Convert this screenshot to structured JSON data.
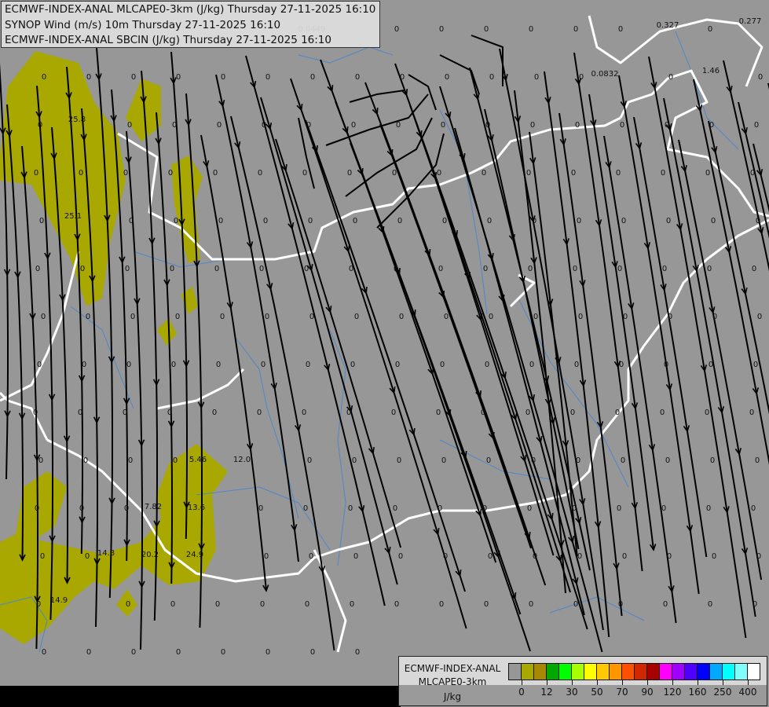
{
  "titles": [
    "ECMWF-INDEX-ANAL MLCAPE0-3km (J/kg) Thursday 27-11-2025 16:10",
    "SYNOP Wind (m/s) 10m Thursday 27-11-2025 16:10",
    "ECMWF-INDEX-ANAL SBCIN (J/kg) Thursday 27-11-2025 16:10"
  ],
  "legend": {
    "name_line1": "ECMWF-INDEX-ANAL",
    "name_line2": "MLCAPE0-3km",
    "unit": "J/kg",
    "colors": [
      "#979797",
      "#a8a800",
      "#a88800",
      "#00a800",
      "#00ff00",
      "#a8ff00",
      "#ffff00",
      "#ffc800",
      "#ff9600",
      "#ff5000",
      "#d02800",
      "#a80000",
      "#ff00ff",
      "#a000ff",
      "#5000ff",
      "#0000ff",
      "#00a8ff",
      "#00ffff",
      "#80ffff",
      "#ffffff"
    ],
    "ticks": [
      "0",
      "12",
      "30",
      "50",
      "70",
      "90",
      "120",
      "160",
      "250",
      "400"
    ]
  },
  "map": {
    "cape_color": "#a8a800",
    "border_color": "#ffffff",
    "river_color": "#4f86c8",
    "values": [
      "25.8",
      "25.1",
      "0.327",
      "0.277",
      "0.0832",
      "1.46",
      "0.0449",
      "5.46",
      "12.0",
      "7.82",
      "13.6",
      "14.8",
      "20.2",
      "24.9",
      "14.9",
      "0"
    ]
  }
}
